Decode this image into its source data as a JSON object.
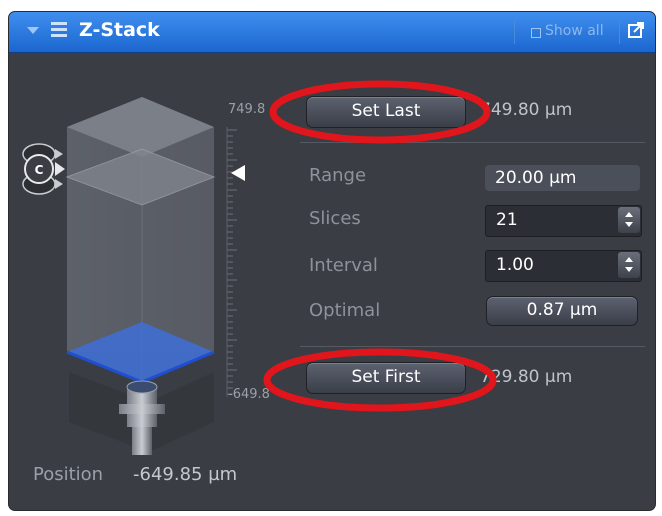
{
  "titlebar": {
    "title": "Z-Stack",
    "show_all_label": "Show all",
    "collapse_icon": "chevron-down-icon",
    "menu_icon": "menu-icon",
    "popout_icon": "popout-icon"
  },
  "stack": {
    "scale_top": "749.8",
    "scale_bottom": "-649.8",
    "channel_label": "C"
  },
  "controls": {
    "set_last_label": "Set Last",
    "set_last_value": "749.80 µm",
    "range_label": "Range",
    "range_value": "20.00 µm",
    "slices_label": "Slices",
    "slices_value": "21",
    "interval_label": "Interval",
    "interval_value": "1.00",
    "optimal_label": "Optimal",
    "optimal_value": "0.87 µm",
    "set_first_label": "Set First",
    "set_first_value": "729.80 µm"
  },
  "position": {
    "label": "Position",
    "value": "-649.85 µm"
  },
  "colors": {
    "titlebar": "#2a7ae2",
    "panel_bg": "#3a3d43",
    "annotation": "#e0161c",
    "plane": "#3f6fd8"
  }
}
